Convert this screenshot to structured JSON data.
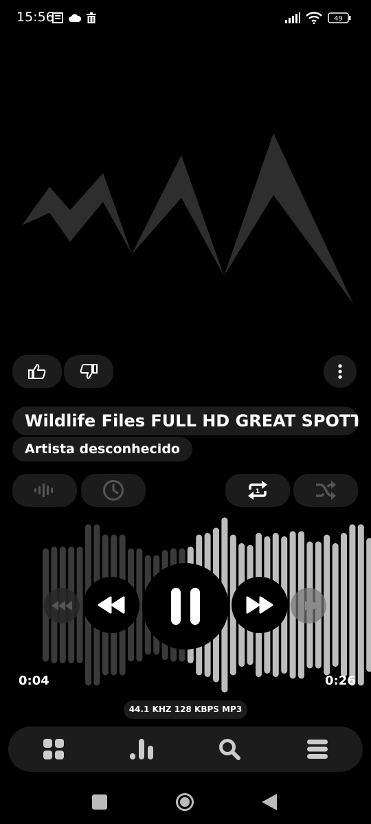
{
  "status_bar": {
    "time": "15:56",
    "battery": "49",
    "icons": [
      "notes-icon",
      "cloud-icon",
      "trash-icon",
      "signal-icon",
      "wifi-icon",
      "battery-icon"
    ]
  },
  "artwork": {
    "icon": "mountain-logo-icon",
    "color": "#2e2e2e"
  },
  "actions": {
    "like_icon": "thumbs-up-icon",
    "dislike_icon": "thumbs-down-icon",
    "menu_icon": "more-vertical-icon"
  },
  "track": {
    "title": "Wildlife Files FULL HD GREAT SPOTT",
    "artist": "Artista desconhecido"
  },
  "controls": {
    "visualizer_icon": "waveform-icon",
    "sleep_timer_icon": "clock-icon",
    "repeat_icon": "repeat-one-icon",
    "shuffle_icon": "shuffle-icon",
    "prev_fast_icon": "rewind-fast-icon",
    "prev_icon": "rewind-icon",
    "play_pause_icon": "pause-icon",
    "next_icon": "fast-forward-icon",
    "next_fast_icon": "fast-forward-fast-icon"
  },
  "progress": {
    "elapsed": "0:04",
    "duration": "0:26",
    "played_fraction": 0.45
  },
  "audio_info": "44.1 KHZ  128 KBPS  MP3",
  "bottom_nav": {
    "items": [
      "grid-icon",
      "equalizer-icon",
      "search-icon",
      "menu-icon"
    ]
  },
  "system_nav": {
    "items": [
      "recents-icon",
      "home-icon",
      "back-icon"
    ]
  },
  "colors": {
    "background": "#000000",
    "surface": "#1c1c1c",
    "wave_played": "#bdbdbd",
    "wave_unplayed": "#3a3a3a"
  }
}
